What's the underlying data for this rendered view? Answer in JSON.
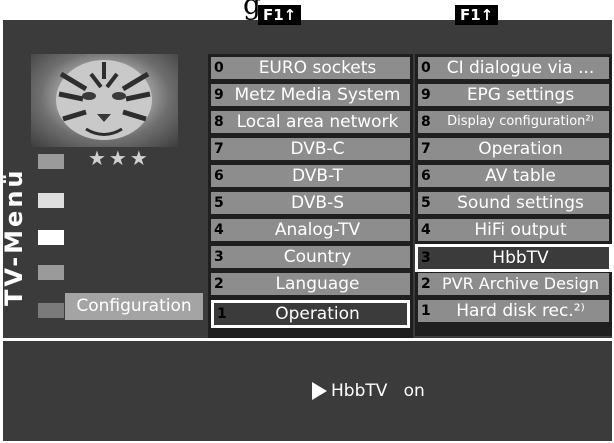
{
  "header": {
    "partial_title": "g"
  },
  "fkeys": [
    "F1↑",
    "F1↑"
  ],
  "preview": {
    "rating": "★★★"
  },
  "sidebar": {
    "vertical_title": "TV-Menü",
    "active_item": "Configuration"
  },
  "column1": {
    "items": [
      {
        "num": "0",
        "label": "EURO sockets"
      },
      {
        "num": "9",
        "label": "Metz Media System"
      },
      {
        "num": "8",
        "label": "Local area network"
      },
      {
        "num": "7",
        "label": "DVB-C"
      },
      {
        "num": "6",
        "label": "DVB-T"
      },
      {
        "num": "5",
        "label": "DVB-S"
      },
      {
        "num": "4",
        "label": "Analog-TV"
      },
      {
        "num": "3",
        "label": "Country"
      },
      {
        "num": "2",
        "label": "Language"
      },
      {
        "num": "1",
        "label": "Operation"
      }
    ],
    "selected_index": 9
  },
  "column2": {
    "items": [
      {
        "num": "0",
        "label": "CI dialogue via ..."
      },
      {
        "num": "9",
        "label": "EPG settings"
      },
      {
        "num": "8",
        "label": "Display configuration²⁾"
      },
      {
        "num": "7",
        "label": "Operation"
      },
      {
        "num": "6",
        "label": "AV table"
      },
      {
        "num": "5",
        "label": "Sound settings"
      },
      {
        "num": "4",
        "label": "HiFi output"
      },
      {
        "num": "3",
        "label": "HbbTV"
      },
      {
        "num": "2",
        "label": "PVR Archive Design"
      },
      {
        "num": "1",
        "label": "Hard disk rec.²⁾"
      }
    ],
    "selected_index": 7
  },
  "status_bar": {
    "setting": "HbbTV",
    "value": "on"
  }
}
